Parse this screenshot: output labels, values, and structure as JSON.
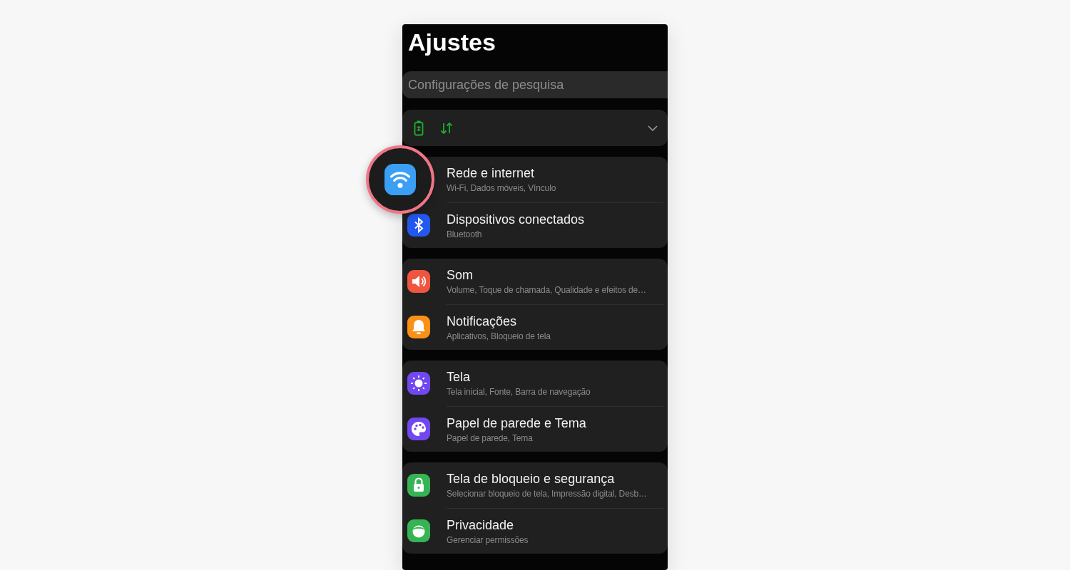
{
  "title": "Ajustes",
  "search": {
    "placeholder": "Configurações de pesquisa"
  },
  "quick_bar": {
    "expanded": false
  },
  "groups": [
    {
      "items": [
        {
          "kind": "wifi",
          "color": "#3a9ff5",
          "title": "Rede e internet",
          "subtitle": "Wi-Fi, Dados móveis, Vínculo",
          "highlighted": true
        },
        {
          "kind": "bluetooth",
          "color": "#2358f0",
          "title": "Dispositivos conectados",
          "subtitle": "Bluetooth",
          "highlighted": false
        }
      ]
    },
    {
      "items": [
        {
          "kind": "sound",
          "color": "#f0553f",
          "title": "Som",
          "subtitle": "Volume, Toque de chamada, Qualidade e efeitos de…",
          "highlighted": false
        },
        {
          "kind": "bell",
          "color": "#fb9016",
          "title": "Notificações",
          "subtitle": "Aplicativos, Bloqueio de tela",
          "highlighted": false
        }
      ]
    },
    {
      "items": [
        {
          "kind": "sun",
          "color": "#7148ef",
          "title": "Tela",
          "subtitle": "Tela inicial, Fonte, Barra de navegação",
          "highlighted": false
        },
        {
          "kind": "palette",
          "color": "#7148ef",
          "title": "Papel de parede e Tema",
          "subtitle": "Papel de parede, Tema",
          "highlighted": false
        }
      ]
    },
    {
      "items": [
        {
          "kind": "lock",
          "color": "#36b455",
          "title": "Tela de bloqueio e segurança",
          "subtitle": "Selecionar bloqueio de tela, Impressão digital, Desb…",
          "highlighted": false
        },
        {
          "kind": "face",
          "color": "#36b455",
          "title": "Privacidade",
          "subtitle": "Gerenciar permissões",
          "highlighted": false
        }
      ]
    }
  ]
}
